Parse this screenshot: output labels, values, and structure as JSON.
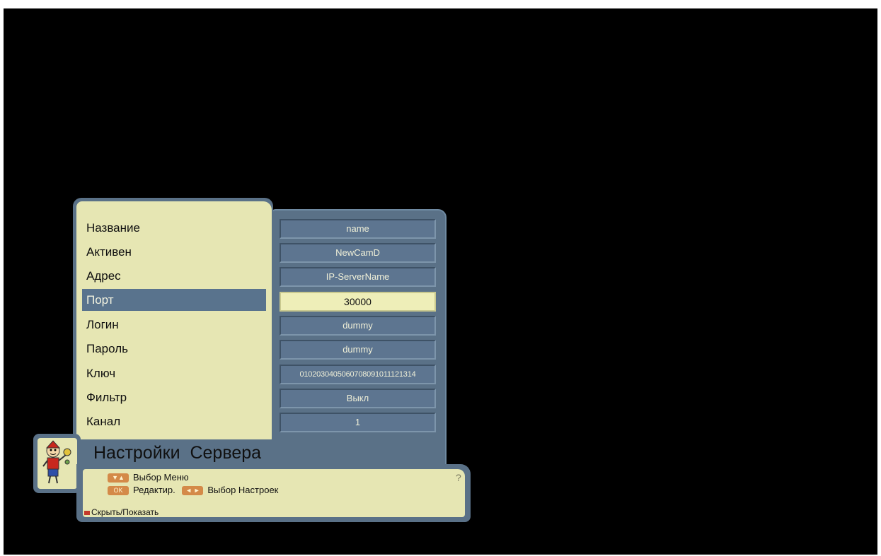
{
  "settings": {
    "rows": [
      {
        "label": "Название",
        "value": "name"
      },
      {
        "label": "Активен",
        "value": "NewCamD"
      },
      {
        "label": "Адрес",
        "value": "IP-ServerName"
      },
      {
        "label": "Порт",
        "value": "30000"
      },
      {
        "label": "Логин",
        "value": "dummy"
      },
      {
        "label": "Пароль",
        "value": "dummy"
      },
      {
        "label": "Ключ",
        "value": "0102030405060708091011121314"
      },
      {
        "label": "Фильтр",
        "value": "Выкл"
      },
      {
        "label": "Канал",
        "value": "1"
      }
    ],
    "selected_index": 3
  },
  "title": "Настройки  Сервера",
  "help": {
    "nav_key": "▼▲",
    "nav_label": "Выбор Меню",
    "ok_key": "OK",
    "ok_label": "Редактир.",
    "lr_key": "◄ ►",
    "lr_label": "Выбор Настроек",
    "hide_label": "Скрыть/Показать",
    "help_icon": "?"
  },
  "colors": {
    "background": "#000000",
    "panel": "#e6e6b3",
    "frame": "#5a7187",
    "selected": "#59738d",
    "key": "#d48a48"
  }
}
